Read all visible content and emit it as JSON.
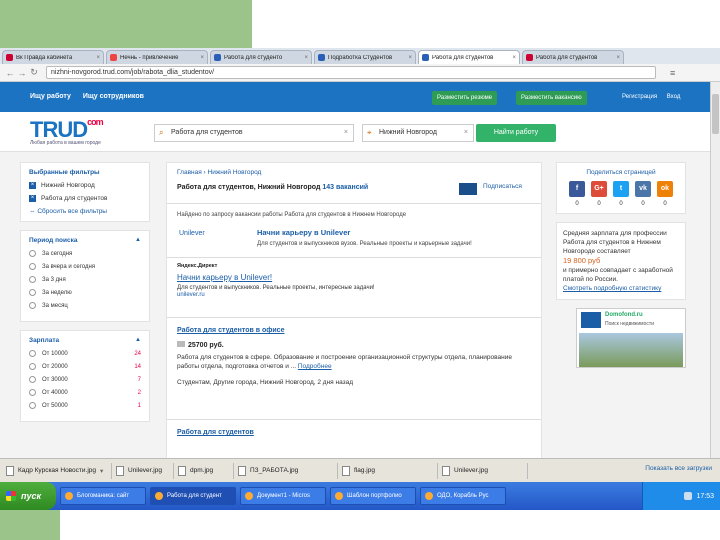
{
  "browser": {
    "tabs": [
      {
        "label": "Вк Правда кабинета",
        "active": false
      },
      {
        "label": "Нечнь - привлечение",
        "active": false
      },
      {
        "label": "Работа для студенто",
        "active": false
      },
      {
        "label": "Подработка Студентов",
        "active": false
      },
      {
        "label": "Работа для студентов",
        "active": true
      },
      {
        "label": "Работа для студентов",
        "active": false
      }
    ],
    "url": "nizhni-novgorod.trud.com/job/rabota_dlia_studentov/"
  },
  "site": {
    "nav_left": [
      "Ищу работу",
      "Ищу сотрудников"
    ],
    "btn_resume": "Разместить резюме",
    "btn_vacancy": "Разместить вакансию",
    "nav_right": [
      "Регистрация",
      "Вход"
    ],
    "logo": "TRUD",
    "logo_com": "com",
    "tagline": "Любая работа в вашем городе",
    "search_query": "Работа для студентов",
    "search_city": "Нижний Новгород",
    "find_button": "Найти работу"
  },
  "filters": {
    "title": "Выбранные фильтры",
    "selected": [
      "Нижний Новгород",
      "Работа для студентов"
    ],
    "reset": "Сбросить все фильтры",
    "period_title": "Период поиска",
    "periods": [
      "За сегодня",
      "За вчера и сегодня",
      "За 3 дня",
      "За неделю",
      "За месяц"
    ],
    "salary_title": "Зарплата",
    "salaries": [
      {
        "label": "От 10000",
        "count": "24"
      },
      {
        "label": "От 20000",
        "count": "14"
      },
      {
        "label": "От 30000",
        "count": "7"
      },
      {
        "label": "От 40000",
        "count": "2"
      },
      {
        "label": "От 50000",
        "count": "1"
      }
    ]
  },
  "main": {
    "breadcrumbs": "Главная › Нижний Новгород",
    "heading": "Работа для студентов, Нижний Новгород",
    "heading_count": "143 вакансий",
    "subscribe": "Подписаться",
    "found_text": "Найдено по запросу вакансии работы Работа для студентов в Нижнем Новгороде",
    "ad1": {
      "logo": "Unilever",
      "title": "Начни карьеру в Unilever",
      "desc": "Для студентов и выпускников вузов. Реальные проекты и карьерные задачи!"
    },
    "ad2": {
      "source": "Яндекс.Директ",
      "title": "Начни карьеру в Unilever!",
      "desc": "Для студентов и выпускников. Реальные проекты, интересные задачи!",
      "url": "unilever.ru"
    },
    "vacancy1": {
      "title": "Работа для студентов в офисе",
      "salary": "25700 руб.",
      "desc": "Работа для студентов в сфере. Образование и построение организационной структуры отдела, планирование работы отдела, подготовка отчетов и ...",
      "more": "Подробнее",
      "footer": "Студентам, Другие города, Нижний Новгород, 2 дня назад"
    },
    "vacancy2": {
      "title": "Работа для студентов"
    }
  },
  "sidebar": {
    "share_title": "Поделиться страницей",
    "social": [
      {
        "glyph": "f",
        "color": "#3b5998",
        "count": "0"
      },
      {
        "glyph": "G+",
        "color": "#dd4b39",
        "count": "0"
      },
      {
        "glyph": "t",
        "color": "#1da1f2",
        "count": "0"
      },
      {
        "glyph": "vk",
        "color": "#4a76a8",
        "count": "0"
      },
      {
        "glyph": "ok",
        "color": "#ee8208",
        "count": "0"
      }
    ],
    "salary_note": "Средняя зарплата для профессии Работа для студентов в Нижнем Новгороде составляет",
    "salary_value": "19 800 руб",
    "salary_note2": "и примерно совпадает с заработной платой по России.",
    "salary_more": "Смотреть подробную статистику",
    "banner_brand": "Domofond.ru",
    "banner_text": "Поиск недвижимости"
  },
  "downloads": {
    "items": [
      "Кадр Курская Новости.jpg",
      "Unilever.jpg",
      "dpm.jpg",
      "ПЗ_РАБОТА.jpg",
      "flag.jpg",
      "Unilever.jpg"
    ],
    "show_all": "Показать все загрузки"
  },
  "taskbar": {
    "start": "пуск",
    "items": [
      {
        "label": "Блогоманика: сайт",
        "active": false
      },
      {
        "label": "Работа для студент",
        "active": true
      },
      {
        "label": "Документ1 - Micros",
        "active": false
      },
      {
        "label": "Шаблон портфолио",
        "active": false
      },
      {
        "label": "ОДО, Корабль Рус",
        "active": false
      }
    ],
    "clock": "17:53"
  }
}
